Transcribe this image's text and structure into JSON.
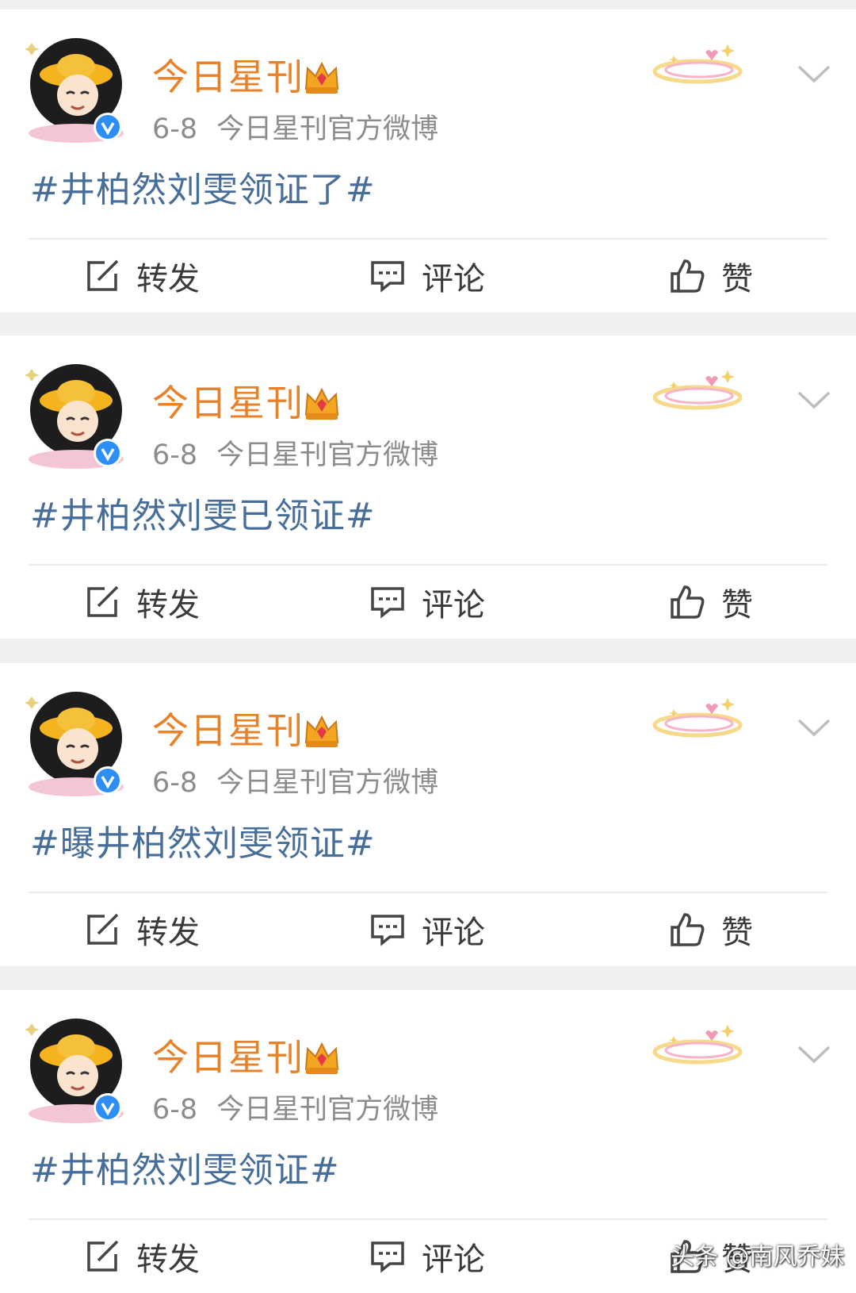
{
  "posts": [
    {
      "author": "今日星刊",
      "date": "6-8",
      "source": "今日星刊官方微博",
      "text": "#井柏然刘雯领证了#",
      "actions": {
        "repost": "转发",
        "comment": "评论",
        "like": "赞"
      }
    },
    {
      "author": "今日星刊",
      "date": "6-8",
      "source": "今日星刊官方微博",
      "text": "#井柏然刘雯已领证#",
      "actions": {
        "repost": "转发",
        "comment": "评论",
        "like": "赞"
      }
    },
    {
      "author": "今日星刊",
      "date": "6-8",
      "source": "今日星刊官方微博",
      "text": "#曝井柏然刘雯领证#",
      "actions": {
        "repost": "转发",
        "comment": "评论",
        "like": "赞"
      }
    },
    {
      "author": "今日星刊",
      "date": "6-8",
      "source": "今日星刊官方微博",
      "text": "#井柏然刘雯领证#",
      "actions": {
        "repost": "转发",
        "comment": "评论",
        "like": "赞"
      }
    }
  ],
  "watermark": "头条 @南风乔妹",
  "icons": {
    "avatar": "cartoon-avatar-icon",
    "verified": "verified-badge-icon",
    "crown": "crown-icon",
    "decoration": "sparkle-ring-decoration-icon",
    "menu": "chevron-down-icon",
    "repost": "repost-icon",
    "comment": "comment-icon",
    "like": "thumbs-up-icon"
  },
  "colors": {
    "author": "#e8822a",
    "hashtag": "#476e9a",
    "meta": "#8c8c8c",
    "background": "#efefef",
    "verified": "#2d8ef5"
  }
}
